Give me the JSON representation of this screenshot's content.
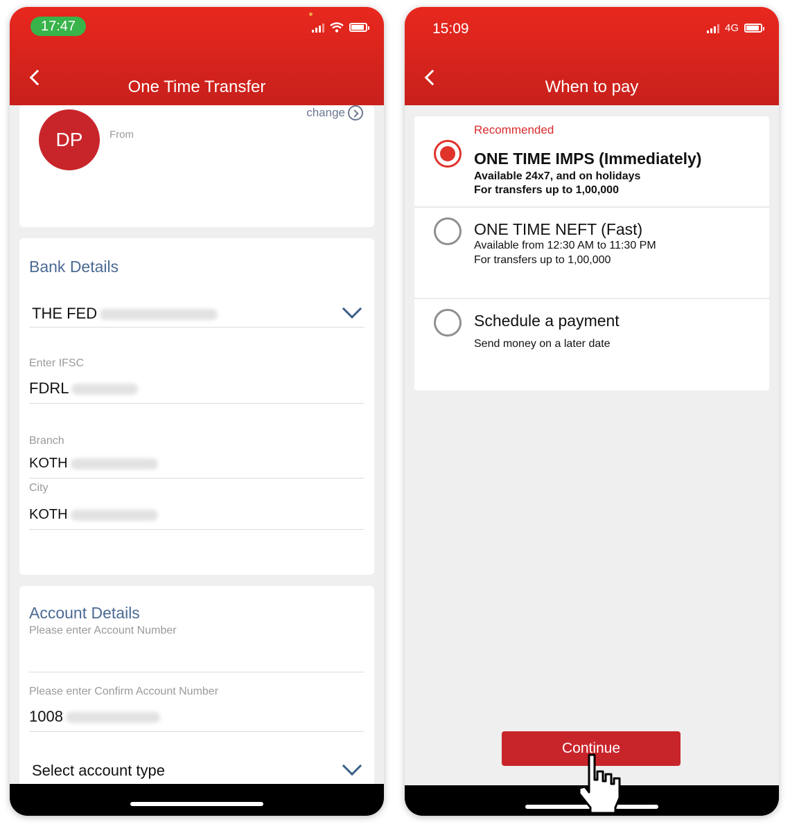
{
  "left": {
    "status": {
      "time": "17:47"
    },
    "header": {
      "title": "One Time Transfer"
    },
    "from_card": {
      "avatar_initials": "DP",
      "from_label": "From",
      "change_label": "change"
    },
    "bank": {
      "title": "Bank Details",
      "bank_name": "THE FED",
      "ifsc_label": "Enter IFSC",
      "ifsc_value": "FDRL",
      "branch_label": "Branch",
      "branch_value": "KOTH",
      "city_label": "City",
      "city_value": "KOTH"
    },
    "account": {
      "title": "Account Details",
      "account_placeholder": "Please enter Account Number",
      "confirm_label": "Please enter Confirm Account Number",
      "confirm_value": "1008",
      "type_label": "Select account type"
    }
  },
  "right": {
    "status": {
      "time": "15:09",
      "network": "4G"
    },
    "header": {
      "title": "When to pay"
    },
    "options": [
      {
        "tag": "Recommended",
        "title": "ONE TIME IMPS (Immediately)",
        "line1": "Available 24x7, and on holidays",
        "line2": "For transfers up to 1,00,000",
        "selected": true
      },
      {
        "title": "ONE TIME NEFT (Fast)",
        "line1": "Available from 12:30 AM to 11:30 PM",
        "line2": "For transfers up to 1,00,000",
        "selected": false
      },
      {
        "title": "Schedule a payment",
        "line1": "Send money on a later date",
        "selected": false
      }
    ],
    "continue_label": "Continue"
  },
  "colors": {
    "brand_red": "#d8292b",
    "section_blue": "#4b6a93",
    "status_green": "#38b44a"
  }
}
